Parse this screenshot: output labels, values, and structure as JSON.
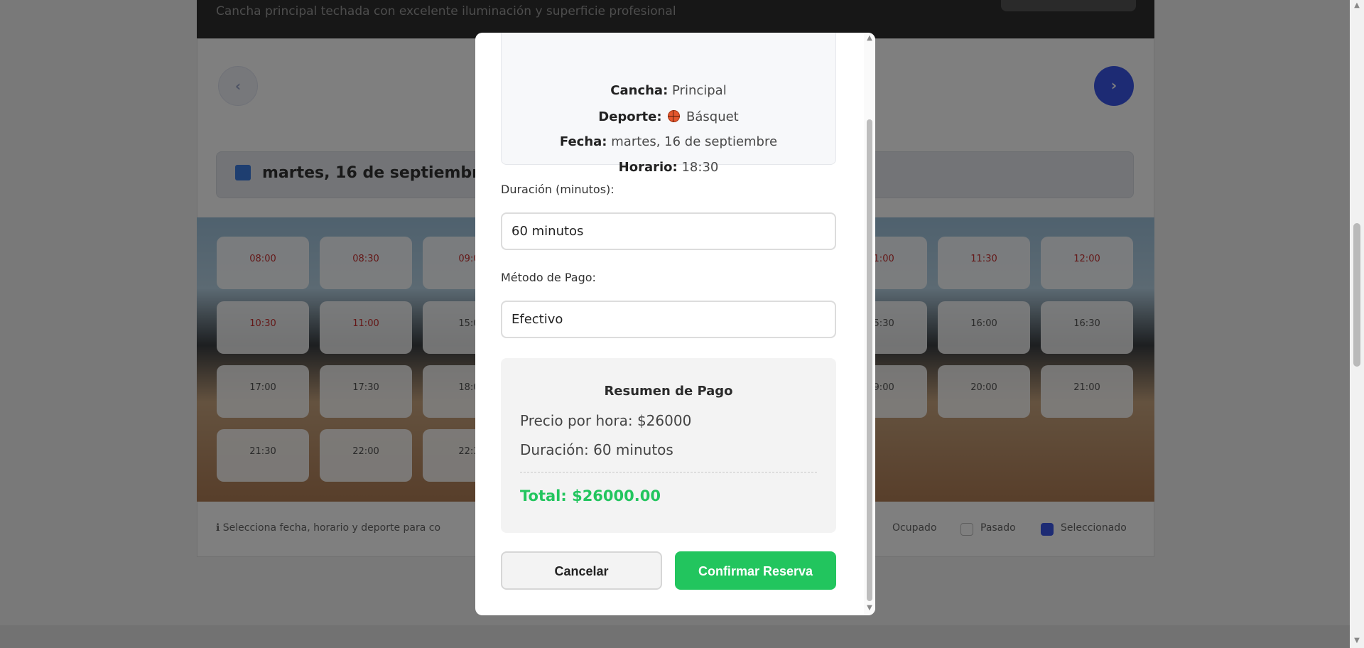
{
  "background": {
    "header_subtitle": "Cancha principal techada con excelente iluminación y superficie profesional",
    "date_bar_text": "martes, 16 de septiembre de 2",
    "slots_row1": [
      "08:00",
      "08:30",
      "09:0",
      "",
      "",
      "",
      "",
      "11:00",
      "11:30",
      "12:00"
    ],
    "slots_row2": [
      "10:30",
      "11:00",
      "15:0",
      "",
      "",
      "",
      "",
      "15:30",
      "16:00",
      "16:30"
    ],
    "slots_row3": [
      "17:00",
      "17:30",
      "18:0",
      "",
      "",
      "",
      "",
      "19:00",
      "20:00",
      "21:00"
    ],
    "slots_row4": [
      "21:30",
      "22:00",
      "22:3"
    ],
    "slot_status_pasado": "Pasado",
    "footer_hint": "ℹ Selecciona fecha, horario y deporte para co",
    "legend": {
      "ocupado": "Ocupado",
      "pasado": "Pasado",
      "seleccionado": "Seleccionado"
    }
  },
  "modal": {
    "info": {
      "cancha_label": "Cancha:",
      "cancha_value": "Principal",
      "deporte_label": "Deporte:",
      "deporte_icon": "basketball-icon",
      "deporte_value": "Básquet",
      "fecha_label": "Fecha:",
      "fecha_value": "martes, 16 de septiembre",
      "horario_label": "Horario:",
      "horario_value": "18:30"
    },
    "duracion_label": "Duración (minutos):",
    "duracion_value": "60 minutos",
    "metodo_label": "Método de Pago:",
    "metodo_value": "Efectivo",
    "summary": {
      "title": "Resumen de Pago",
      "precio": "Precio por hora: $26000",
      "duracion": "Duración: 60 minutos",
      "total": "Total: $26000.00"
    },
    "buttons": {
      "cancel": "Cancelar",
      "confirm": "Confirmar Reserva"
    }
  },
  "colors": {
    "confirm_green": "#22c55e",
    "accent_blue": "#3a56e8"
  }
}
